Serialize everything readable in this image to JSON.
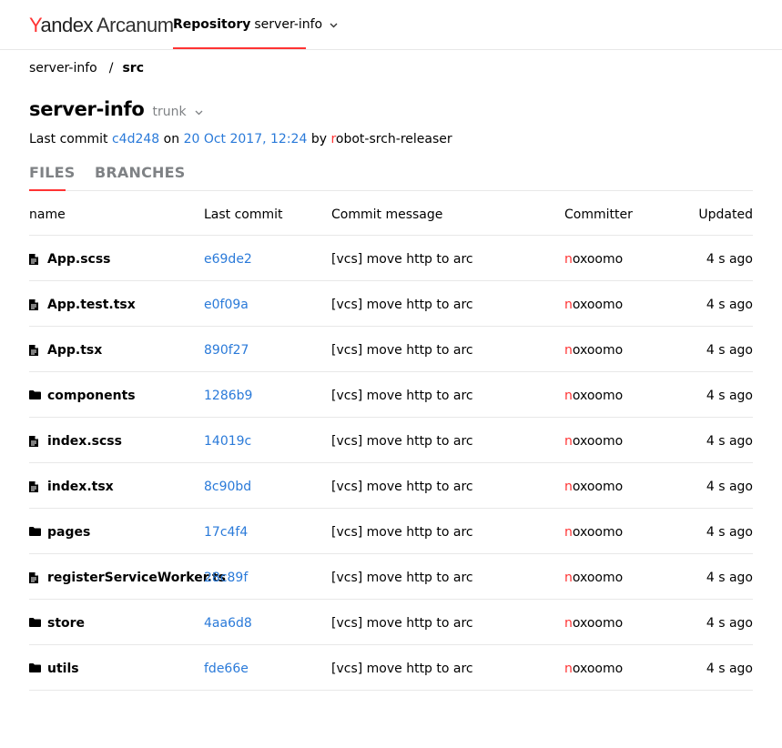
{
  "header": {
    "logo_y": "Y",
    "logo_andex": "andex",
    "logo_arcanum": "Arcanum",
    "repo_label": "Repository",
    "repo_name": "server-info"
  },
  "breadcrumb": {
    "root": "server-info",
    "separator": "/",
    "current": "src"
  },
  "title": {
    "name": "server-info",
    "branch": "trunk"
  },
  "last_commit": {
    "prefix": "Last commit",
    "hash": "c4d248",
    "on": "on",
    "date": "20 Oct 2017, 12:24",
    "by": "by",
    "author_first": "r",
    "author_rest": "obot-srch-releaser"
  },
  "tabs": {
    "files": "FILES",
    "branches": "BRANCHES"
  },
  "table": {
    "columns": {
      "name": "name",
      "last_commit": "Last commit",
      "message": "Commit message",
      "committer": "Committer",
      "updated": "Updated"
    },
    "rows": [
      {
        "type": "file",
        "name": "App.scss",
        "commit": "e69de2",
        "message": "[vcs] move http to arc",
        "committer_first": "n",
        "committer_rest": "oxoomo",
        "updated": "4 s ago"
      },
      {
        "type": "file",
        "name": "App.test.tsx",
        "commit": "e0f09a",
        "message": "[vcs] move http to arc",
        "committer_first": "n",
        "committer_rest": "oxoomo",
        "updated": "4 s ago"
      },
      {
        "type": "file",
        "name": "App.tsx",
        "commit": "890f27",
        "message": "[vcs] move http to arc",
        "committer_first": "n",
        "committer_rest": "oxoomo",
        "updated": "4 s ago"
      },
      {
        "type": "folder",
        "name": "components",
        "commit": "1286b9",
        "message": "[vcs] move http to arc",
        "committer_first": "n",
        "committer_rest": "oxoomo",
        "updated": "4 s ago"
      },
      {
        "type": "file",
        "name": "index.scss",
        "commit": "14019c",
        "message": "[vcs] move http to arc",
        "committer_first": "n",
        "committer_rest": "oxoomo",
        "updated": "4 s ago"
      },
      {
        "type": "file",
        "name": "index.tsx",
        "commit": "8c90bd",
        "message": "[vcs] move http to arc",
        "committer_first": "n",
        "committer_rest": "oxoomo",
        "updated": "4 s ago"
      },
      {
        "type": "folder",
        "name": "pages",
        "commit": "17c4f4",
        "message": "[vcs] move http to arc",
        "committer_first": "n",
        "committer_rest": "oxoomo",
        "updated": "4 s ago"
      },
      {
        "type": "file",
        "name": "registerServiceWorker.ts",
        "commit": "28c89f",
        "message": "[vcs] move http to arc",
        "committer_first": "n",
        "committer_rest": "oxoomo",
        "updated": "4 s ago"
      },
      {
        "type": "folder",
        "name": "store",
        "commit": "4aa6d8",
        "message": "[vcs] move http to arc",
        "committer_first": "n",
        "committer_rest": "oxoomo",
        "updated": "4 s ago"
      },
      {
        "type": "folder",
        "name": "utils",
        "commit": "fde66e",
        "message": "[vcs] move http to arc",
        "committer_first": "n",
        "committer_rest": "oxoomo",
        "updated": "4 s ago"
      }
    ]
  },
  "colors": {
    "accent": "#ff3333",
    "link": "#2a7ad9",
    "muted": "#7f8285",
    "divider": "#e8e8e8"
  },
  "icons": {
    "file": "file-icon",
    "folder": "folder-icon",
    "chevron": "chevron-down-icon"
  }
}
